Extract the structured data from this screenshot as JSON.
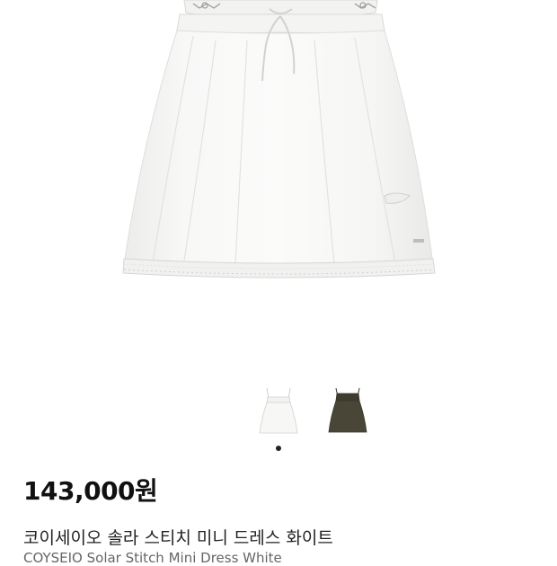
{
  "product": {
    "price": "143,000원",
    "name": "코이세이오 솔라 스티치 미니 드레스 화이트",
    "name_en": "COYSEIO Solar Stitch Mini Dress White"
  },
  "gallery": {
    "thumbnails": [
      "white-dress",
      "olive-dress"
    ],
    "active_index": 0
  },
  "colors": {
    "dress_white": "#f7f7f5",
    "dress_olive": "#4a4637",
    "dot_active": "#222222"
  }
}
